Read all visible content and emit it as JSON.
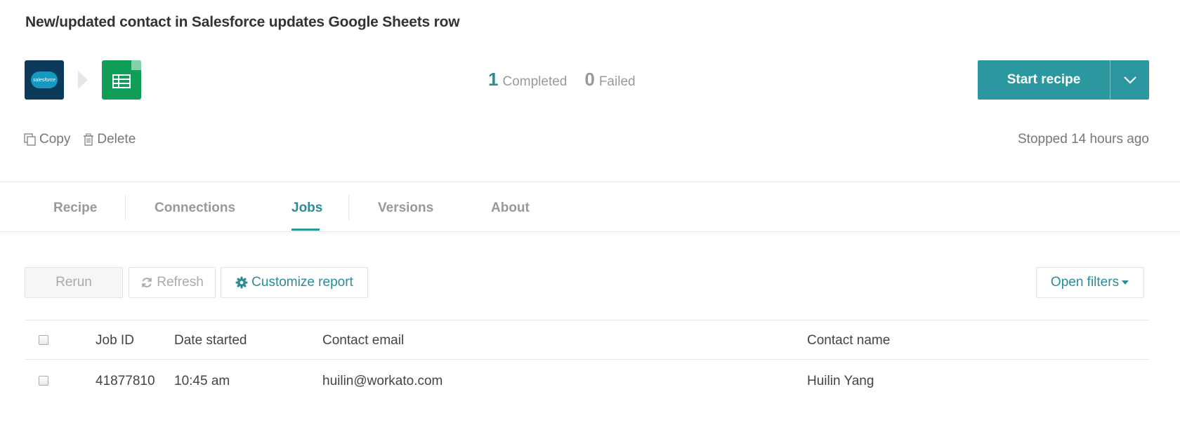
{
  "recipe": {
    "title": "New/updated contact in Salesforce updates Google Sheets row",
    "apps": [
      {
        "icon": "salesforce-icon",
        "label": "salesforce"
      },
      {
        "icon": "google-sheets-icon"
      }
    ]
  },
  "stats": {
    "completed_count": "1",
    "completed_label": "Completed",
    "failed_count": "0",
    "failed_label": "Failed"
  },
  "start_button": {
    "label": "Start recipe"
  },
  "actions": {
    "copy": "Copy",
    "delete": "Delete"
  },
  "status_text": "Stopped 14 hours ago",
  "tabs": [
    {
      "label": "Recipe",
      "active": false
    },
    {
      "label": "Connections",
      "active": false
    },
    {
      "label": "Jobs",
      "active": true
    },
    {
      "label": "Versions",
      "active": false
    },
    {
      "label": "About",
      "active": false
    }
  ],
  "toolbar": {
    "rerun": "Rerun",
    "refresh": "Refresh",
    "customize": "Customize report",
    "open_filters": "Open filters"
  },
  "table": {
    "columns": [
      "Job ID",
      "Date started",
      "Contact email",
      "Contact name"
    ],
    "rows": [
      {
        "job_id": "41877810",
        "date_started": "10:45 am",
        "contact_email": "huilin@workato.com",
        "contact_name": "Huilin Yang"
      }
    ]
  },
  "colors": {
    "accent": "#2b98a0",
    "salesforce_bg": "#0b3a5a",
    "sheets_bg": "#0f9d58"
  }
}
